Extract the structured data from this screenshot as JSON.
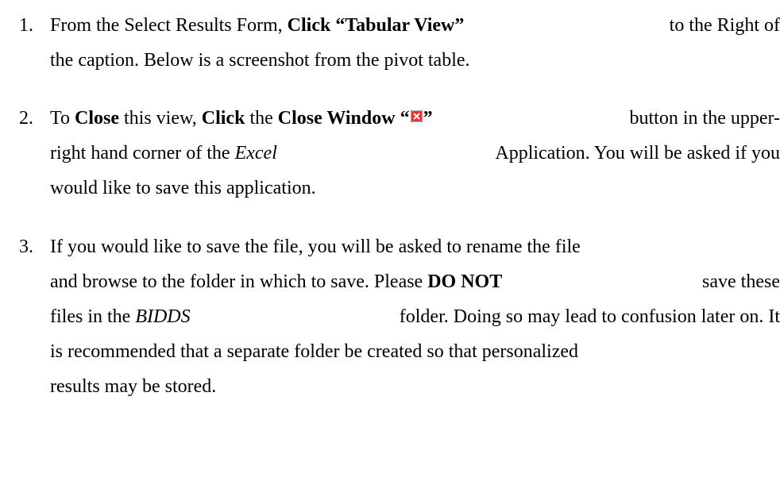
{
  "steps": [
    {
      "number": "1.",
      "line1": {
        "a": "From the Select Results Form, ",
        "b": "Click “Tabular View”",
        "c": " to the Right of"
      },
      "line2": "the caption.  Below is a screenshot from the pivot table."
    },
    {
      "number": "2.",
      "line1": {
        "a": "To ",
        "b": "Close",
        "c": " this view, ",
        "d": "Click",
        "e": " the ",
        "f": "Close Window “",
        "g": "”",
        "h": " button in the upper-"
      },
      "line2": {
        "a": "right hand corner of the ",
        "b": "Excel",
        "c": " Application.  You will be asked if you"
      },
      "line3": "would like to save this application."
    },
    {
      "number": "3.",
      "line1": "If you would like to save the file, you will be asked to rename the file",
      "line2": {
        "a": "and browse to the folder in which to save.  Please ",
        "b": "DO NOT",
        "c": " save these"
      },
      "line3": {
        "a": "files in the ",
        "b": "BIDDS",
        "c": " folder.  Doing so may lead to confusion later on.  It"
      },
      "line4": "is recommended that a separate folder be created so that personalized",
      "line5": "results may be stored."
    }
  ],
  "icons": {
    "close_window": "close-window-icon",
    "close_fill": "#e8372f"
  }
}
